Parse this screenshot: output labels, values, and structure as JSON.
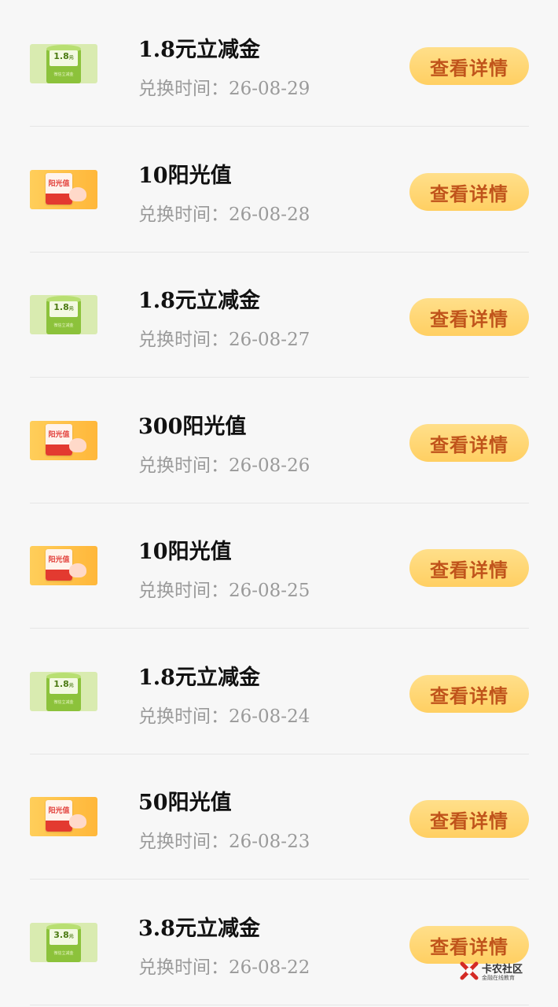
{
  "labels": {
    "date_prefix": "兑换时间：",
    "detail_button": "查看详情"
  },
  "items": [
    {
      "type": "green",
      "title": "1.8元立减金",
      "date": "26-08-29",
      "thumb_amount": "1.8",
      "thumb_unit": "元",
      "thumb_sub": "微信立减金"
    },
    {
      "type": "orange",
      "title": "10阳光值",
      "date": "26-08-28",
      "thumb_text": "阳光值"
    },
    {
      "type": "green",
      "title": "1.8元立减金",
      "date": "26-08-27",
      "thumb_amount": "1.8",
      "thumb_unit": "元",
      "thumb_sub": "微信立减金"
    },
    {
      "type": "orange",
      "title": "300阳光值",
      "date": "26-08-26",
      "thumb_text": "阳光值"
    },
    {
      "type": "orange",
      "title": "10阳光值",
      "date": "26-08-25",
      "thumb_text": "阳光值"
    },
    {
      "type": "green",
      "title": "1.8元立减金",
      "date": "26-08-24",
      "thumb_amount": "1.8",
      "thumb_unit": "元",
      "thumb_sub": "微信立减金"
    },
    {
      "type": "orange",
      "title": "50阳光值",
      "date": "26-08-23",
      "thumb_text": "阳光值"
    },
    {
      "type": "green",
      "title": "3.8元立减金",
      "date": "26-08-22",
      "thumb_amount": "3.8",
      "thumb_unit": "元",
      "thumb_sub": "微信立减金"
    }
  ],
  "watermark": {
    "name": "卡农社区",
    "tagline": "金融在线教育"
  },
  "colors": {
    "button_bg": "#ffd774",
    "button_text": "#c0541b",
    "green_thumb": "#d9ebb0",
    "orange_thumb": "#ffc24a"
  }
}
